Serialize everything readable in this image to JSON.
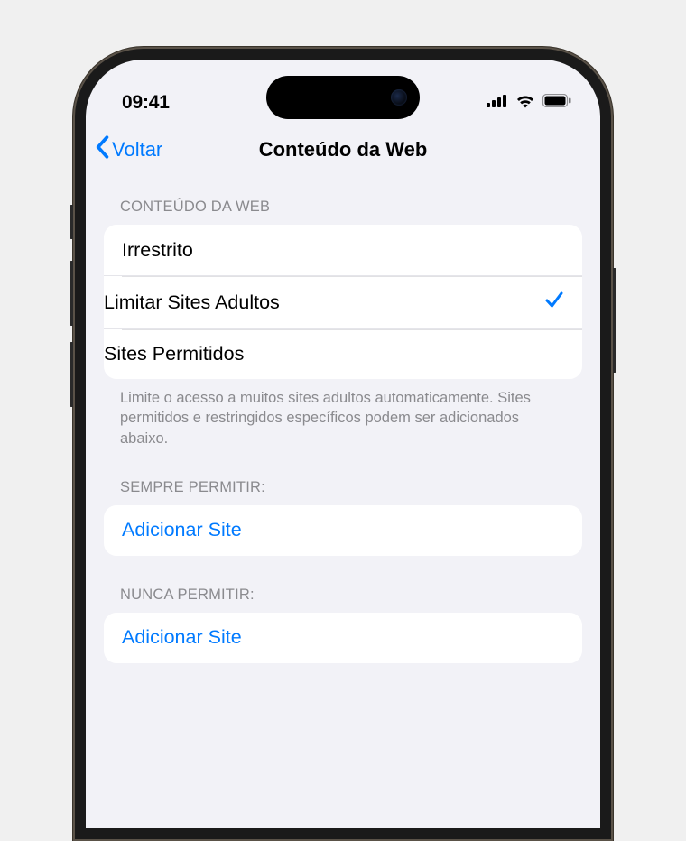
{
  "status": {
    "time": "09:41"
  },
  "nav": {
    "back_label": "Voltar",
    "title": "Conteúdo da Web"
  },
  "web_content": {
    "header": "CONTEÚDO DA WEB",
    "options": [
      {
        "label": "Irrestrito",
        "selected": false
      },
      {
        "label": "Limitar Sites Adultos",
        "selected": true
      },
      {
        "label": "Sites Permitidos",
        "selected": false
      }
    ],
    "footer": "Limite o acesso a muitos sites adultos automaticamente. Sites permitidos e restringidos específicos podem ser adicionados abaixo."
  },
  "always_allow": {
    "header": "SEMPRE PERMITIR:",
    "add_label": "Adicionar Site"
  },
  "never_allow": {
    "header": "NUNCA PERMITIR:",
    "add_label": "Adicionar Site"
  },
  "colors": {
    "link": "#007aff"
  }
}
